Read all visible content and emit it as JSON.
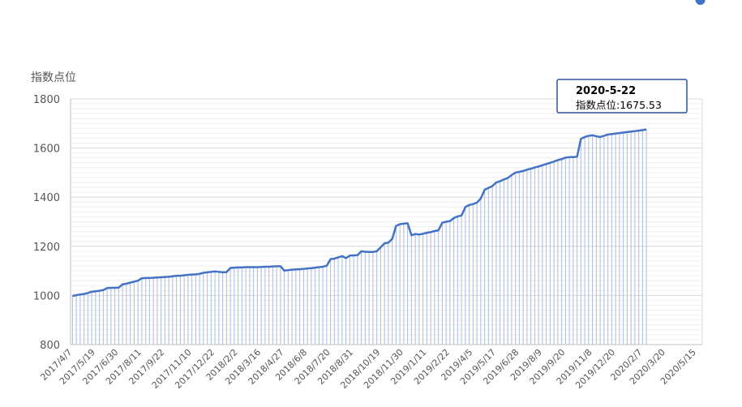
{
  "chart_data": {
    "type": "line",
    "ylabel": "指数点位",
    "ylim": [
      800,
      1800
    ],
    "yticks": [
      800,
      1000,
      1200,
      1400,
      1600,
      1800
    ],
    "grid": true,
    "x": [
      "2017/4/7",
      "2017/4/14",
      "2017/4/21",
      "2017/4/28",
      "2017/5/5",
      "2017/5/12",
      "2017/5/19",
      "2017/5/26",
      "2017/6/2",
      "2017/6/9",
      "2017/6/16",
      "2017/6/23",
      "2017/6/30",
      "2017/7/7",
      "2017/7/14",
      "2017/7/21",
      "2017/7/28",
      "2017/8/4",
      "2017/8/11",
      "2017/8/18",
      "2017/8/25",
      "2017/9/1",
      "2017/9/8",
      "2017/9/15",
      "2017/9/22",
      "2017/9/29",
      "2017/10/6",
      "2017/10/13",
      "2017/10/20",
      "2017/10/27",
      "2017/11/3",
      "2017/11/10",
      "2017/11/17",
      "2017/11/24",
      "2017/12/1",
      "2017/12/8",
      "2017/12/15",
      "2017/12/22",
      "2017/12/29",
      "2018/1/5",
      "2018/1/12",
      "2018/1/19",
      "2018/1/26",
      "2018/2/2",
      "2018/2/9",
      "2018/2/16",
      "2018/2/23",
      "2018/3/2",
      "2018/3/9",
      "2018/3/16",
      "2018/3/23",
      "2018/3/30",
      "2018/4/6",
      "2018/4/13",
      "2018/4/20",
      "2018/4/27",
      "2018/5/4",
      "2018/5/11",
      "2018/5/18",
      "2018/5/25",
      "2018/6/1",
      "2018/6/8",
      "2018/6/15",
      "2018/6/22",
      "2018/6/29",
      "2018/7/6",
      "2018/7/13",
      "2018/7/20",
      "2018/7/27",
      "2018/8/3",
      "2018/8/10",
      "2018/8/17",
      "2018/8/24",
      "2018/8/31",
      "2018/9/7",
      "2018/9/14",
      "2018/9/21",
      "2018/9/28",
      "2018/10/5",
      "2018/10/12",
      "2018/10/19",
      "2018/10/26",
      "2018/11/2",
      "2018/11/9",
      "2018/11/16",
      "2018/11/23",
      "2018/11/30",
      "2018/12/7",
      "2018/12/14",
      "2018/12/21",
      "2018/12/28",
      "2019/1/4",
      "2019/1/11",
      "2019/1/18",
      "2019/1/25",
      "2019/2/1",
      "2019/2/8",
      "2019/2/15",
      "2019/2/22",
      "2019/3/1",
      "2019/3/8",
      "2019/3/15",
      "2019/3/22",
      "2019/3/29",
      "2019/4/5",
      "2019/4/12",
      "2019/4/19",
      "2019/4/26",
      "2019/5/3",
      "2019/5/10",
      "2019/5/17",
      "2019/5/24",
      "2019/5/31",
      "2019/6/7",
      "2019/6/14",
      "2019/6/21",
      "2019/6/28",
      "2019/7/5",
      "2019/7/12",
      "2019/7/19",
      "2019/7/26",
      "2019/8/2",
      "2019/8/9",
      "2019/8/16",
      "2019/8/23",
      "2019/8/30",
      "2019/9/6",
      "2019/9/13",
      "2019/9/20",
      "2019/9/27",
      "2019/10/4",
      "2019/10/11",
      "2019/10/18",
      "2019/10/25",
      "2019/11/1",
      "2019/11/8",
      "2019/11/15",
      "2019/11/22",
      "2019/11/29",
      "2019/12/6",
      "2019/12/13",
      "2019/12/20",
      "2019/12/27",
      "2020/1/3",
      "2020/1/10",
      "2020/1/17",
      "2020/1/24",
      "2020/1/31",
      "2020/2/7",
      "2020/2/14",
      "2020/2/21",
      "2020/2/28",
      "2020/3/6",
      "2020/3/13",
      "2020/3/20",
      "2020/3/27",
      "2020/4/3",
      "2020/4/10",
      "2020/4/17",
      "2020/4/24",
      "2020/5/1",
      "2020/5/8",
      "2020/5/15",
      "2020/5/22"
    ],
    "xtick_labels": [
      "2017/4/7",
      "2017/5/19",
      "2017/6/30",
      "2017/8/11",
      "2017/9/22",
      "2017/11/10",
      "2017/12/22",
      "2018/2/2",
      "2018/3/16",
      "2018/4/27",
      "2018/6/8",
      "2018/7/20",
      "2018/8/31",
      "2018/10/19",
      "2018/11/30",
      "2019/1/11",
      "2019/2/22",
      "2019/4/5",
      "2019/5/17",
      "2019/6/28",
      "2019/8/9",
      "2019/9/20",
      "2019/11/8",
      "2019/12/20",
      "2020/2/7",
      "2020/3/20",
      "2020/5/15"
    ],
    "series": [
      {
        "color": "#4472c4",
        "values": [
          998,
          1001,
          1004,
          1006,
          1010,
          1015,
          1017,
          1019,
          1022,
          1030,
          1031,
          1031,
          1032,
          1045,
          1048,
          1052,
          1056,
          1060,
          1070,
          1071,
          1071,
          1072,
          1073,
          1074,
          1075,
          1076,
          1078,
          1080,
          1080,
          1082,
          1084,
          1085,
          1086,
          1088,
          1092,
          1094,
          1096,
          1098,
          1096,
          1094,
          1095,
          1112,
          1113,
          1114,
          1114,
          1115,
          1115,
          1115,
          1115,
          1116,
          1117,
          1117,
          1118,
          1119,
          1119,
          1101,
          1103,
          1105,
          1106,
          1107,
          1108,
          1110,
          1111,
          1113,
          1115,
          1117,
          1121,
          1148,
          1150,
          1155,
          1160,
          1152,
          1162,
          1163,
          1164,
          1180,
          1178,
          1177,
          1177,
          1180,
          1196,
          1212,
          1215,
          1230,
          1283,
          1290,
          1292,
          1294,
          1245,
          1250,
          1248,
          1251,
          1255,
          1258,
          1262,
          1265,
          1296,
          1300,
          1303,
          1315,
          1322,
          1325,
          1360,
          1368,
          1372,
          1378,
          1395,
          1430,
          1438,
          1445,
          1460,
          1465,
          1472,
          1478,
          1490,
          1500,
          1503,
          1507,
          1512,
          1516,
          1521,
          1525,
          1530,
          1535,
          1540,
          1545,
          1551,
          1555,
          1561,
          1563,
          1563,
          1565,
          1638,
          1645,
          1650,
          1652,
          1648,
          1645,
          1650,
          1655,
          1657,
          1659,
          1661,
          1663,
          1665,
          1667,
          1669,
          1671,
          1673,
          1675.53
        ]
      }
    ]
  },
  "tooltip": {
    "date": "2020-5-22",
    "value_text": "指数点位:1675.53"
  }
}
